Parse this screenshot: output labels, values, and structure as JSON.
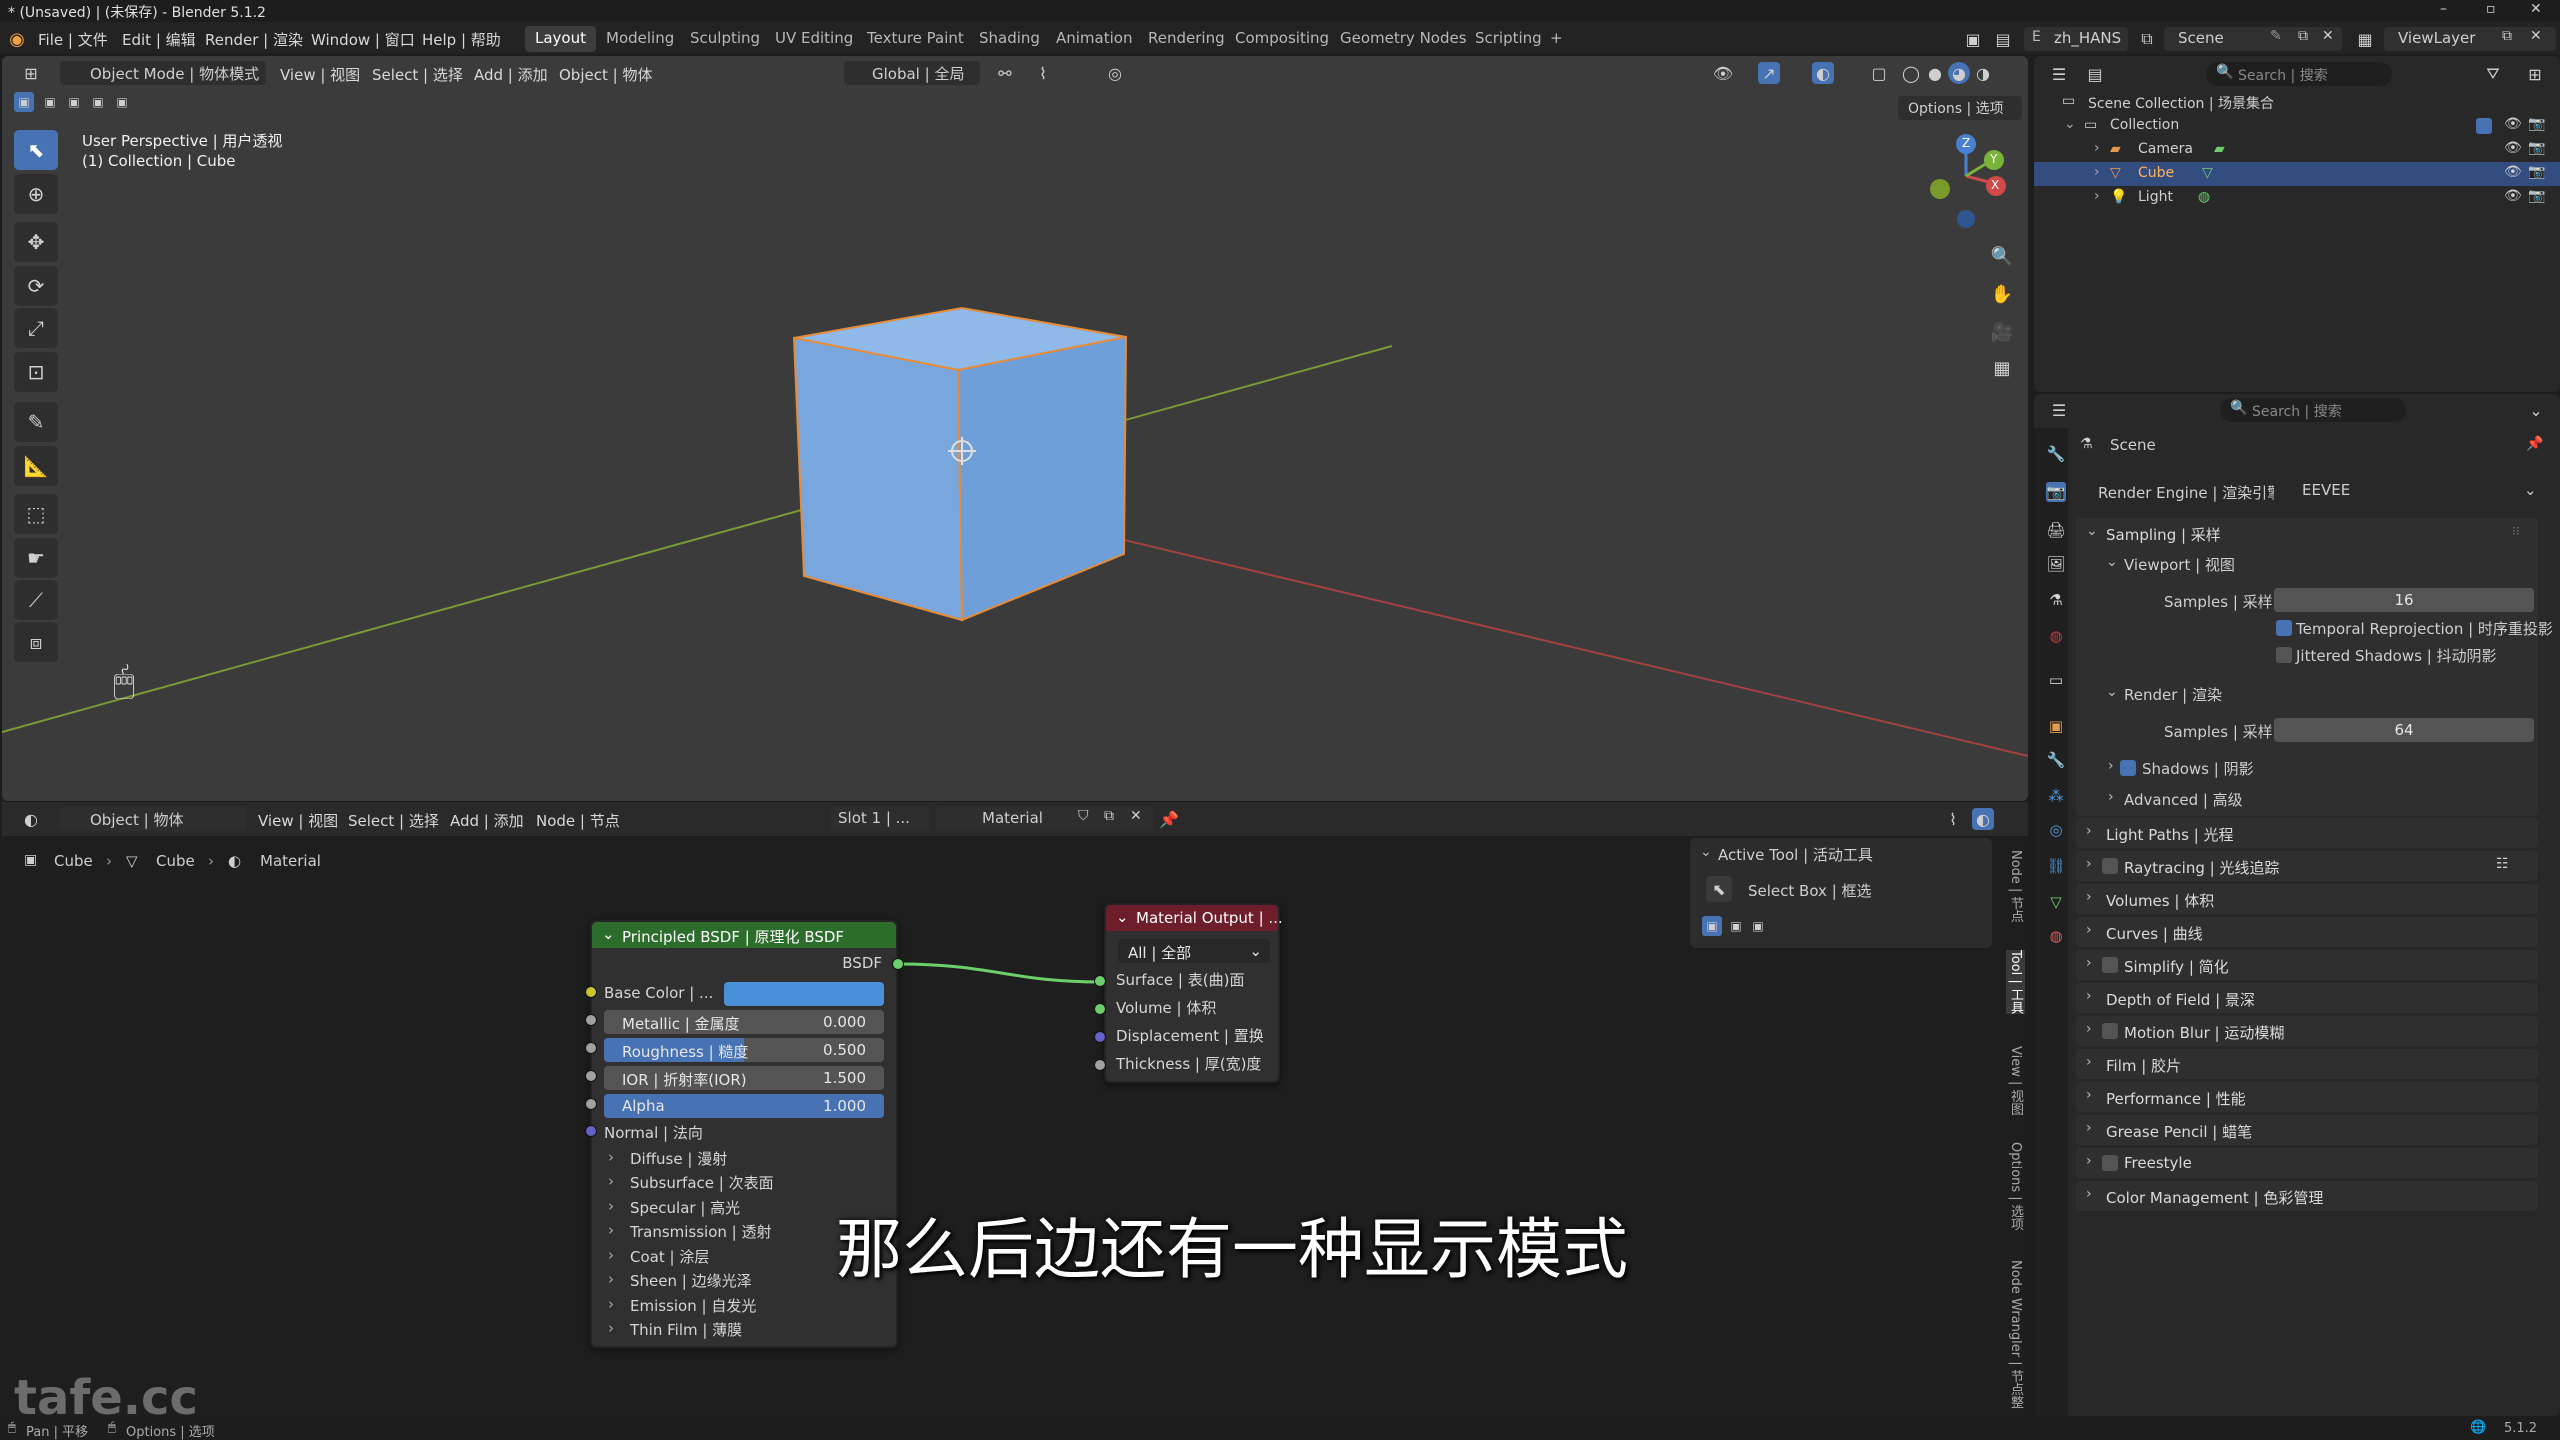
{
  "titlebar": {
    "title": "* (Unsaved) | (未保存) - Blender 5.1.2",
    "min": "–",
    "max": "▫",
    "close": "✕"
  },
  "menubar": {
    "menus": [
      "File | 文件",
      "Edit | 编辑",
      "Render | 渲染",
      "Window | 窗口",
      "Help | 帮助"
    ],
    "workspaces": [
      "Layout",
      "Modeling",
      "Sculpting",
      "UV Editing",
      "Texture Paint",
      "Shading",
      "Animation",
      "Rendering",
      "Compositing",
      "Geometry Nodes",
      "Scripting"
    ],
    "add_ws": "+",
    "language": "zh_HANS",
    "scene": "Scene",
    "viewlayer": "ViewLayer"
  },
  "viewport": {
    "mode": "Object Mode | 物体模式",
    "menus": [
      "View | 视图",
      "Select | 选择",
      "Add | 添加",
      "Object | 物体"
    ],
    "transform": "Global | 全局",
    "options": "Options | 选项",
    "info1": "User Perspective | 用户透视",
    "info2": "(1) Collection | Cube",
    "axis_x": "X",
    "axis_y": "Y",
    "axis_z": "Z"
  },
  "node_editor": {
    "mode": "Object | 物体",
    "menus": [
      "View | 视图",
      "Select | 选择",
      "Add | 添加",
      "Node | 节点"
    ],
    "slot": "Slot 1 | ...",
    "material": "Material",
    "breadcrumb": [
      "Cube",
      "Cube",
      "Material"
    ],
    "bsdf": {
      "title": "Principled BSDF | 原理化 BSDF",
      "output": "BSDF",
      "base_color": "Base Color | ...",
      "metallic": {
        "label": "Metallic | 金属度",
        "value": "0.000"
      },
      "roughness": {
        "label": "Roughness | 糙度",
        "value": "0.500"
      },
      "ior": {
        "label": "IOR | 折射率(IOR)",
        "value": "1.500"
      },
      "alpha": {
        "label": "Alpha",
        "value": "1.000"
      },
      "normal": "Normal | 法向",
      "subpanels": [
        "Diffuse | 漫射",
        "Subsurface | 次表面",
        "Specular | 高光",
        "Transmission | 透射",
        "Coat | 涂层",
        "Sheen | 边缘光泽",
        "Emission | 自发光",
        "Thin Film | 薄膜"
      ]
    },
    "output": {
      "title": "Material Output | ...",
      "target": "All | 全部",
      "sockets": [
        "Surface | 表(曲)面",
        "Volume | 体积",
        "Displacement | 置换",
        "Thickness | 厚(宽)度"
      ]
    },
    "active_tool": {
      "title": "Active Tool | 活动工具",
      "tool": "Select Box | 框选"
    },
    "side_tabs": [
      "Node | 节点",
      "Tool | 工具",
      "View | 视图",
      "Options | 选项",
      "Node Wrangler | 节点整"
    ],
    "subtitle": "那么后边还有一种显示模式",
    "watermark": "tafe.cc"
  },
  "outliner": {
    "search": "Search | 搜索",
    "items": [
      {
        "label": "Scene Collection | 场景集合"
      },
      {
        "label": "Collection"
      },
      {
        "label": "Camera"
      },
      {
        "label": "Cube"
      },
      {
        "label": "Light"
      }
    ]
  },
  "properties": {
    "search": "Search | 搜索",
    "scene": "Scene",
    "render_engine_label": "Render Engine | 渲染引擎",
    "render_engine": "EEVEE",
    "sampling": "Sampling | 采样",
    "viewport": "Viewport | 视图",
    "samples_label": "Samples | 采样",
    "viewport_samples": "16",
    "temporal": "Temporal Reprojection | 时序重投影",
    "jittered": "Jittered Shadows | 抖动阴影",
    "render": "Render | 渲染",
    "render_samples": "64",
    "shadows": "Shadows | 阴影",
    "advanced": "Advanced | 高级",
    "panels": [
      "Light Paths | 光程",
      "Raytracing | 光线追踪",
      "Volumes | 体积",
      "Curves | 曲线",
      "Simplify | 简化",
      "Depth of Field | 景深",
      "Motion Blur | 运动模糊",
      "Film | 胶片",
      "Performance | 性能",
      "Grease Pencil | 蜡笔",
      "Freestyle",
      "Color Management | 色彩管理"
    ]
  },
  "statusbar": {
    "pan": "Pan | 平移",
    "options": "Options | 选项",
    "version": "5.1.2"
  }
}
